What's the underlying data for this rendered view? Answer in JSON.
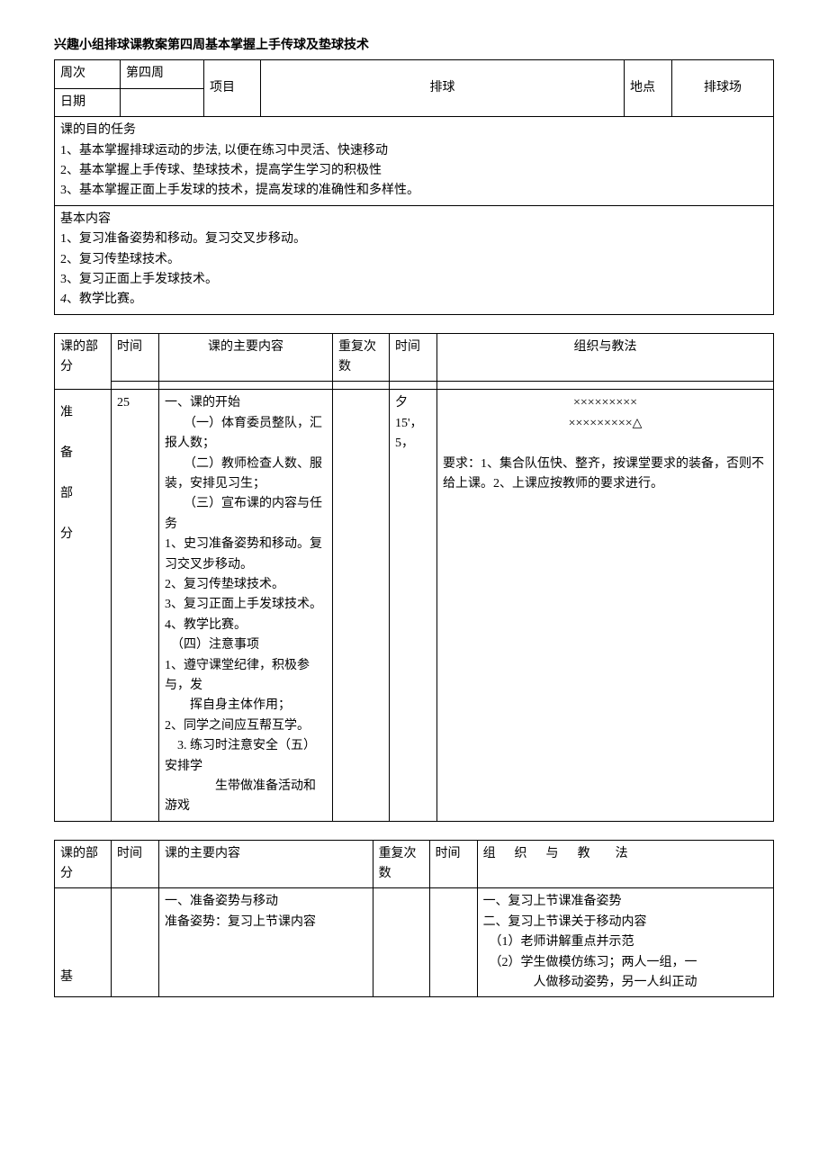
{
  "title": "兴趣小组排球课教案第四周基本掌握上手传球及垫球技术",
  "header": {
    "week_label": "周次",
    "week_value": "第四周",
    "date_label": "日期",
    "date_value": "",
    "subject_label": "项目",
    "subject_value": "排球",
    "location_label": "地点",
    "location_value": "排球场"
  },
  "objectives": {
    "heading": "课的目的任务",
    "items": [
      "1、基本掌握排球运动的步法, 以便在练习中灵活、快速移动",
      "2、基本掌握上手传球、垫球技术，提高学生学习的积极性",
      "3、基本掌握正面上手发球的技术，提高发球的准确性和多样性。"
    ]
  },
  "content": {
    "heading": "基本内容",
    "items": [
      "1、复习准备姿势和移动。复习交叉步移动。",
      "2、复习传垫球技术。",
      "3、复习正面上手发球技术。",
      "4、教学比赛。"
    ],
    "prefix4": "4"
  },
  "schedule1": {
    "col_part": "课的部分",
    "col_time": "时间",
    "col_main": "课的主要内容",
    "col_repeat": "重复次数",
    "col_time2": "时间",
    "col_org": "组织与教法",
    "part_label_lines": [
      "准",
      "备",
      "部",
      "分"
    ],
    "time_value": "25",
    "main_text": "一、课的开始\n　　（一）体育委员整队，汇报人数；\n　　（二）教师检查人数、服装，安排见习生；\n　　（三）宣布课的内容与任务\n1、史习准备姿势和移动。复习交叉步移动。\n2、复习传垫球技术。\n3、复习正面上手发球技术。\n4、教学比赛。\n　（四）注意事项\n1、遵守课堂纪律，积极参与，发\n　　挥自身主体作用；\n2、同学之间应互帮互学。\n　3. 练习时注意安全（五）安排学\n　　　　生带做准备活动和游戏",
    "repeat_value": "",
    "time2_values": [
      "夕",
      "",
      "",
      "15'，",
      "",
      "5，"
    ],
    "org_text": "×××××××××\n×××××××××△\n\n要求：1、集合队伍快、整齐，按课堂要求的装备，否则不给上课。2、上课应按教师的要求进行。"
  },
  "schedule2": {
    "col_part": "课的部分",
    "col_time": "时间",
    "col_main": "课的主要内容",
    "col_repeat": "重复次数",
    "col_time2": "时间",
    "col_org": "组　　织　　与　　教法",
    "part_label": "基",
    "main_text": "一、准备姿势与移动\n准备姿势：复习上节课内容",
    "org_text": "一、复习上节课准备姿势\n二、复习上节课关于移动内容\n　（1）老师讲解重点并示范\n　（2）学生做模仿练习；两人一组，一\n　　　　人做移动姿势，另一人纠正动"
  }
}
